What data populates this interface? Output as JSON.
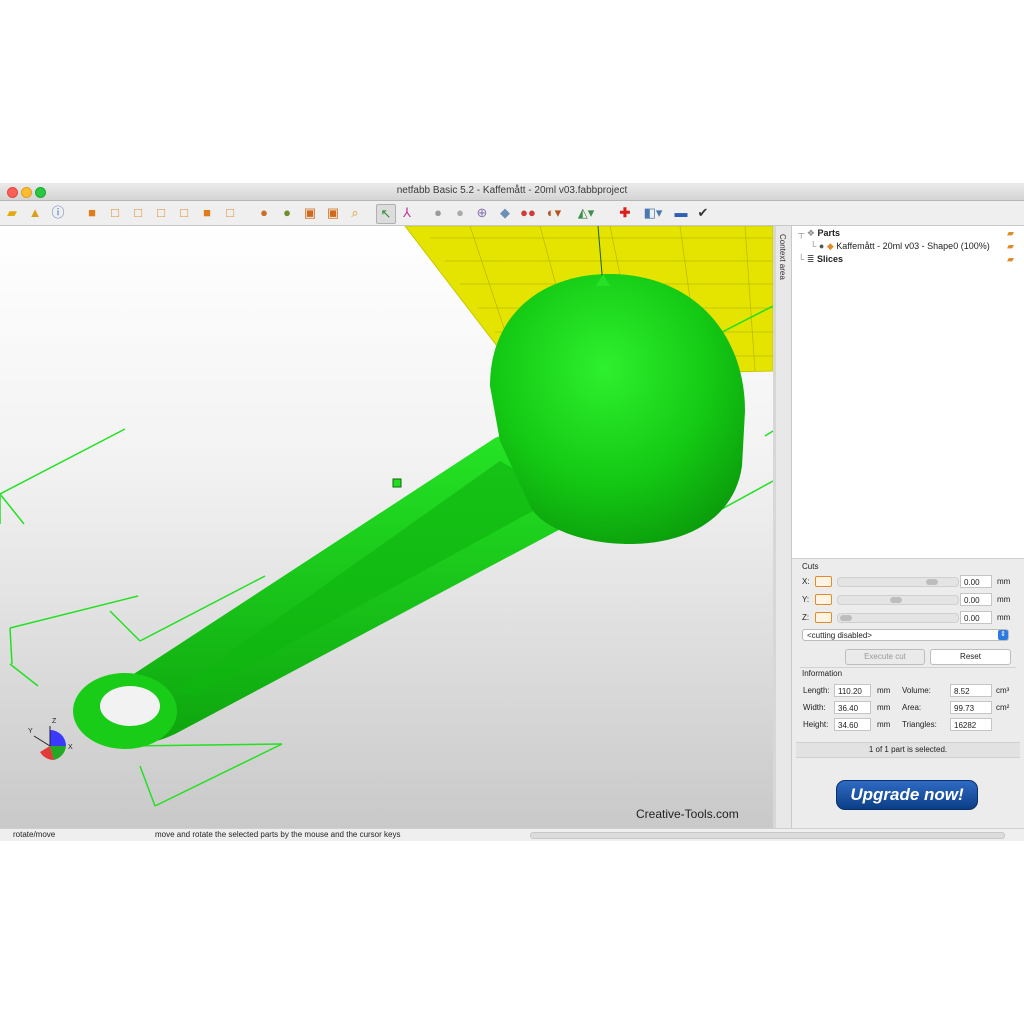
{
  "window": {
    "title": "netfabb Basic 5.2 - Kaffemått - 20ml v03.fabbproject"
  },
  "colors": {
    "model": "#1fd11f",
    "platform": "#e4e400",
    "accent": "#0a5fd1",
    "upgrade": "#0b3e86"
  },
  "toolbar": {
    "icons": [
      "open-file-icon",
      "add-part-icon",
      "info-icon",
      "view-front-icon",
      "view-back-icon",
      "view-left-icon",
      "view-right-icon",
      "view-top-icon",
      "view-bottom-icon",
      "view-perspective-icon",
      "repair-icon",
      "mesh-icon",
      "box-icon",
      "cube-icon",
      "zoom-icon",
      "select-arrow-icon",
      "move-axis-icon",
      "sphere-icon",
      "lighting-icon",
      "measure-icon",
      "color-icon",
      "toggle-icon",
      "analysis-icon",
      "slice-icon",
      "add-red-cross-icon",
      "shading-icon",
      "minus-icon",
      "checkmark-icon"
    ]
  },
  "viewport": {
    "watermark": "Creative-Tools.com",
    "axes": {
      "x": "X",
      "y": "Y",
      "z": "Z"
    }
  },
  "sidebar": {
    "tab_label": "Context area"
  },
  "tree": {
    "parts_label": "Parts",
    "part_name": "Kaffemått - 20ml v03 - Shape0 (100%)",
    "slices_label": "Slices"
  },
  "cuts": {
    "title": "Cuts",
    "x_label": "X:",
    "x_value": "0.00",
    "y_label": "Y:",
    "y_value": "0.00",
    "z_label": "Z:",
    "z_value": "0.00",
    "unit": "mm",
    "mode": "<cutting disabled>",
    "execute_label": "Execute cut",
    "reset_label": "Reset"
  },
  "information": {
    "title": "Information",
    "length_label": "Length:",
    "length_value": "110.20",
    "width_label": "Width:",
    "width_value": "36.40",
    "height_label": "Height:",
    "height_value": "34.60",
    "mm": "mm",
    "volume_label": "Volume:",
    "volume_value": "8.52",
    "volume_unit": "cm³",
    "area_label": "Area:",
    "area_value": "99.73",
    "area_unit": "cm²",
    "triangles_label": "Triangles:",
    "triangles_value": "16282"
  },
  "selection_status": "1 of 1 part is selected.",
  "upgrade_label": "Upgrade now!",
  "statusbar": {
    "mode": "rotate/move",
    "hint": "move and rotate the selected parts by the mouse and the cursor keys"
  }
}
